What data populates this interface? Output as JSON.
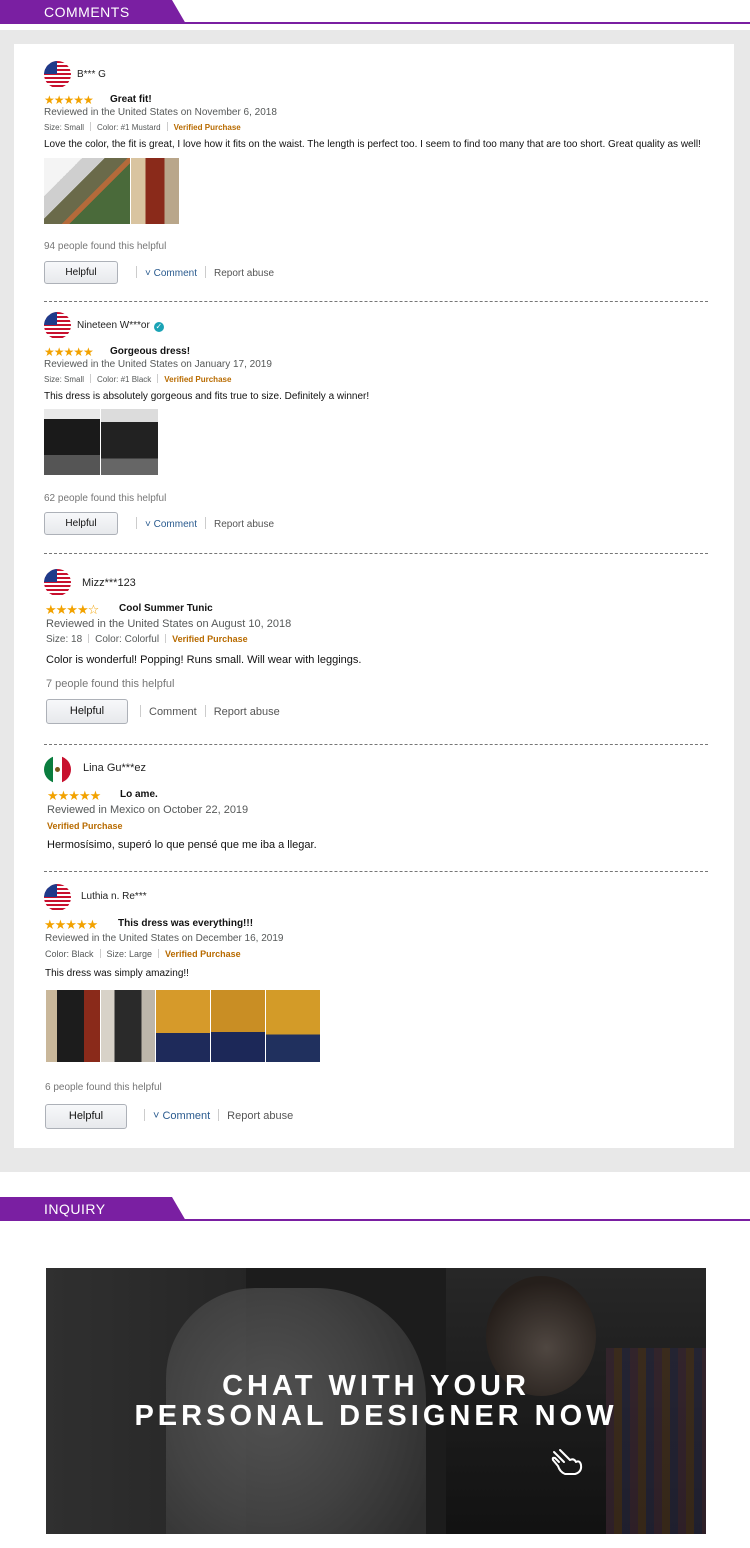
{
  "comments_header": "COMMENTS",
  "inquiry_header": "INQUIRY",
  "reviews": [
    {
      "name": "B*** G",
      "flag": "us-flag-icon",
      "rating": "★★★★★",
      "title": "Great fit!",
      "reviewed": "Reviewed in the United States on November 6, 2018",
      "size": "Size: Small",
      "color": "Color: #1 Mustard",
      "verified": "Verified Purchase",
      "body": "Love the color, the fit is great, I love how it fits on the waist. The length is perfect too. I seem to find too many that are too short. Great quality as well!",
      "helpful_text": "94 people found this helpful",
      "helpful_label": "Helpful",
      "comment_label": "Comment",
      "report_label": "Report abuse"
    },
    {
      "name": "Nineteen W***or",
      "flag": "us-flag-icon",
      "rating": "★★★★★",
      "title": "Gorgeous dress!",
      "reviewed": "Reviewed in the United States on January 17, 2019",
      "size": "Size: Small",
      "color": "Color: #1 Black",
      "verified": "Verified Purchase",
      "body": "This dress is absolutely gorgeous and fits true to size. Definitely a winner!",
      "helpful_text": "62 people found this helpful",
      "helpful_label": "Helpful",
      "comment_label": "Comment",
      "report_label": "Report abuse"
    },
    {
      "name": "Mizz***123",
      "flag": "us-flag-icon",
      "rating": "★★★★☆",
      "title": "Cool Summer Tunic",
      "reviewed": "Reviewed in the United States on August 10, 2018",
      "size": "Size: 18",
      "color": "Color: Colorful",
      "verified": "Verified Purchase",
      "body": "Color is wonderful! Popping! Runs small. Will wear with leggings.",
      "helpful_text": "7 people found this helpful",
      "helpful_label": "Helpful",
      "comment_label": "Comment",
      "report_label": "Report abuse"
    },
    {
      "name": "Lina Gu***ez",
      "flag": "mexico-flag-icon",
      "rating": "★★★★★",
      "title": "Lo ame.",
      "reviewed": "Reviewed in Mexico on October 22, 2019",
      "verified": "Verified Purchase",
      "body": "Hermosísimo, superó lo que pensé que me iba a llegar."
    },
    {
      "name": "Luthia n. Re***",
      "flag": "us-flag-icon",
      "rating": "★★★★★",
      "title": "This dress was everything!!!",
      "reviewed": "Reviewed in the United States on December 16, 2019",
      "color": "Color: Black",
      "size": "Size: Large",
      "verified": "Verified Purchase",
      "body": "This dress was simply amazing!!",
      "helpful_text": "6 people found this helpful",
      "helpful_label": "Helpful",
      "comment_label": "Comment",
      "report_label": "Report abuse"
    }
  ],
  "banner": {
    "line1": "CHAT WITH YOUR",
    "line2": "PERSONAL DESIGNER NOW",
    "icon": "hand-pointer-icon"
  }
}
